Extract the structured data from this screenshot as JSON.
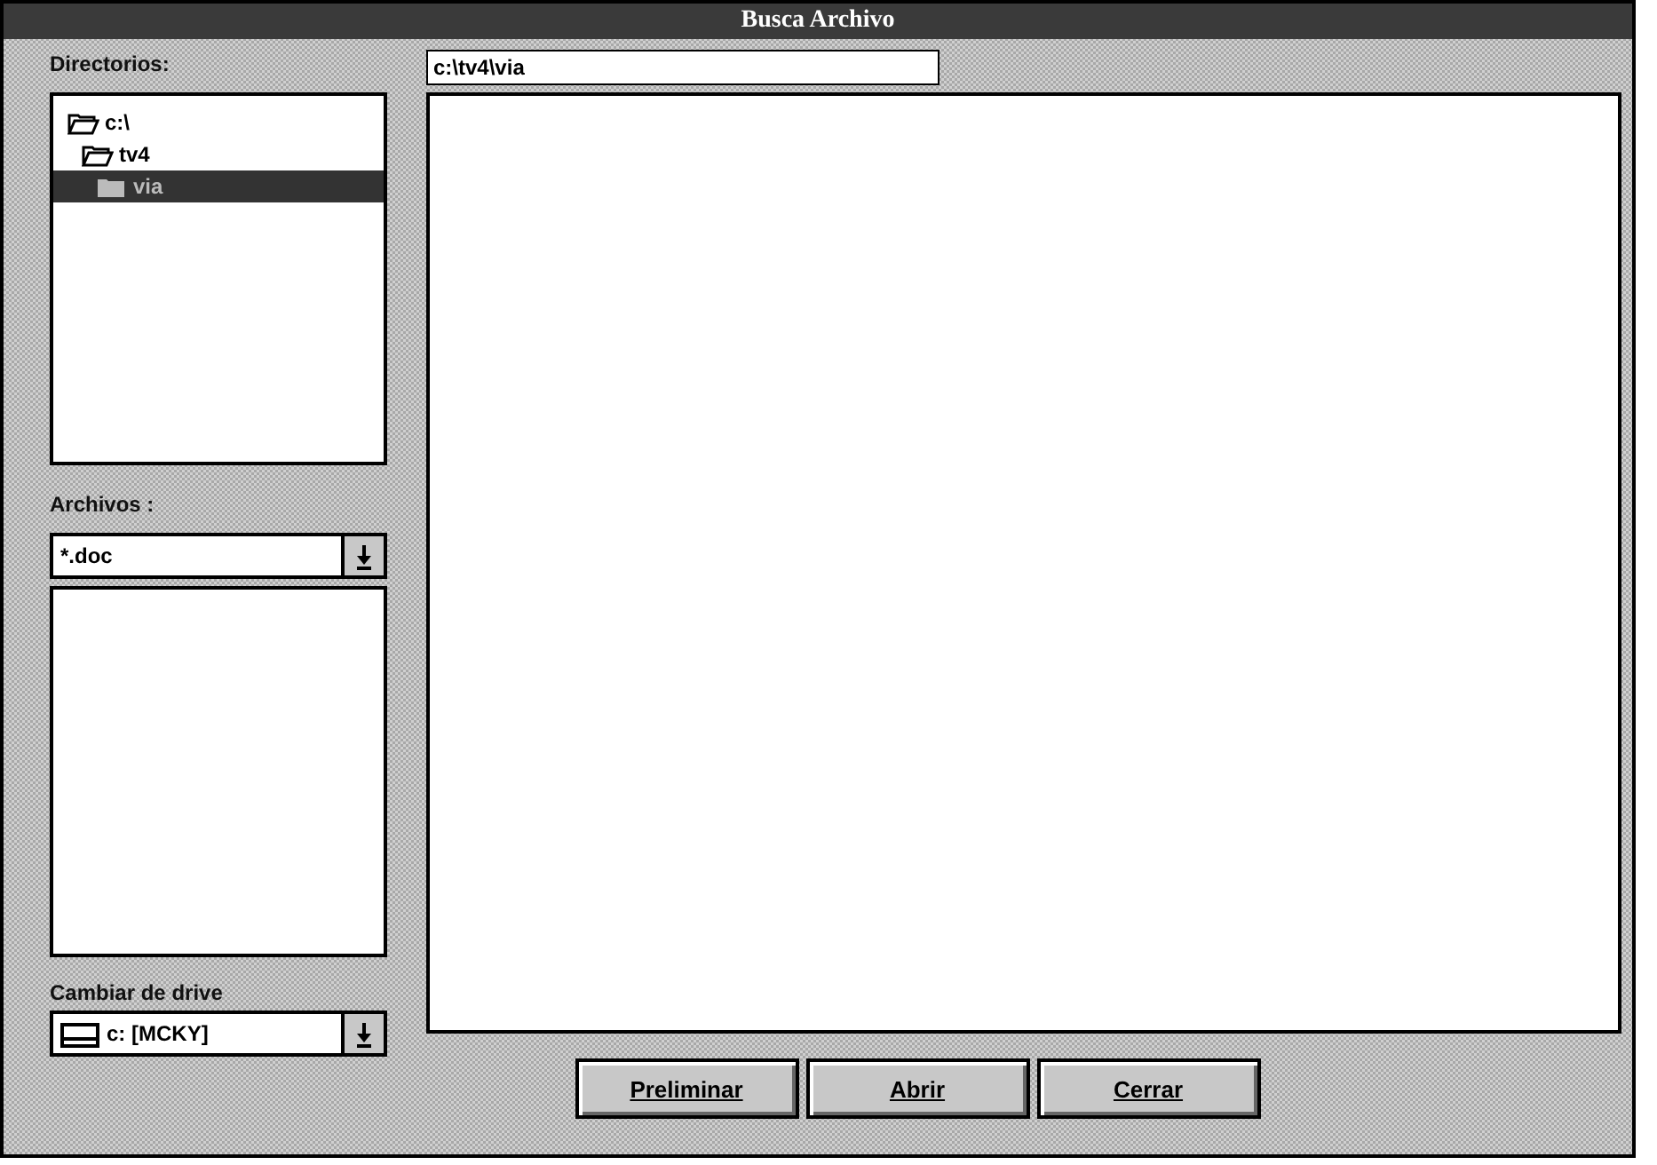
{
  "window": {
    "title": "Busca Archivo"
  },
  "directories": {
    "label": "Directorios:",
    "tree": [
      {
        "name": "c:\\",
        "selected": false,
        "children": [
          {
            "name": "tv4",
            "selected": false,
            "children": [
              {
                "name": "via",
                "selected": true
              }
            ]
          }
        ]
      }
    ]
  },
  "path_field": {
    "value": "c:\\tv4\\via"
  },
  "files": {
    "label": "Archivos :",
    "filter": "*.doc"
  },
  "drive": {
    "label": "Cambiar de drive",
    "value": "c: [MCKY]"
  },
  "buttons": [
    "Preliminar",
    "Abrir",
    "Cerrar"
  ]
}
